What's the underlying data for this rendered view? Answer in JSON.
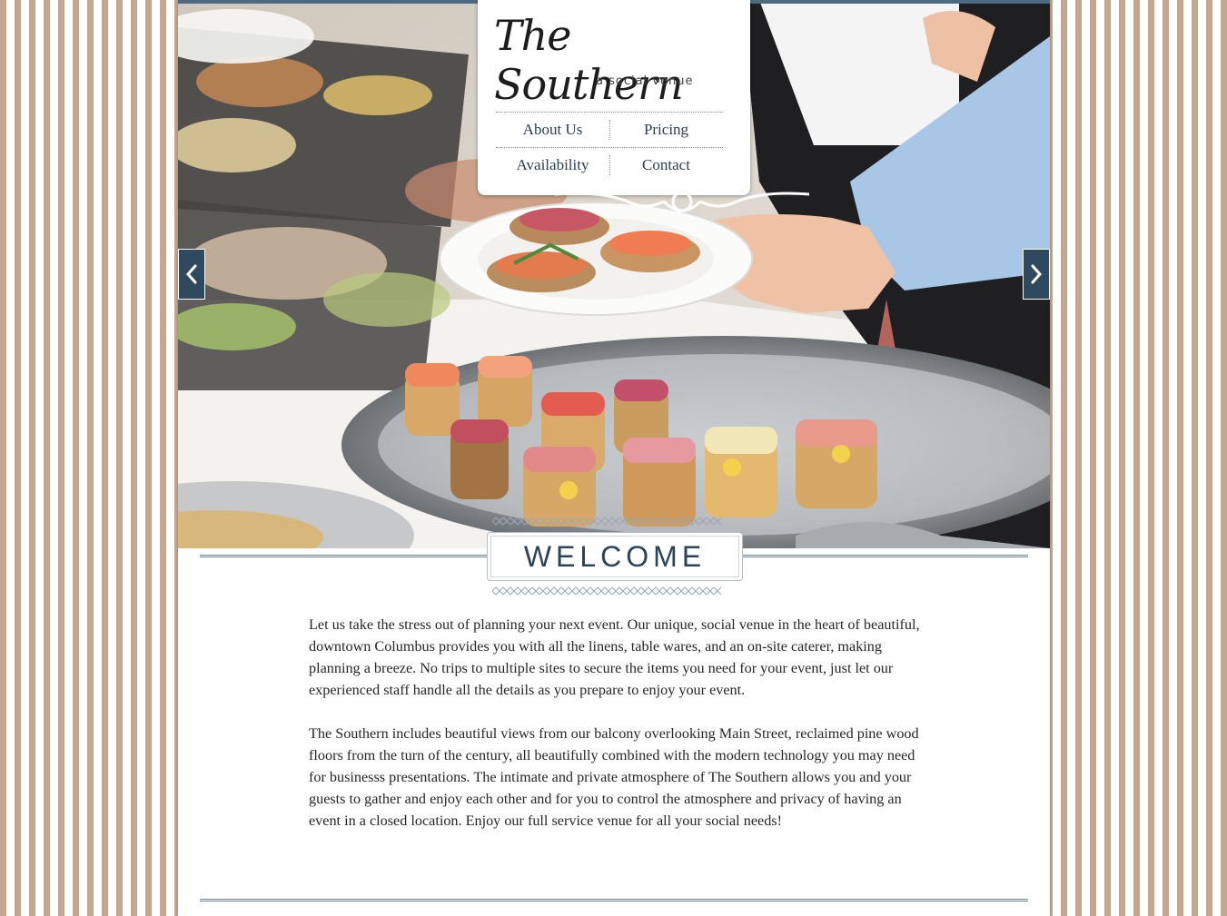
{
  "brand": {
    "logo_script": "The Southern",
    "tagline": "a social venue"
  },
  "nav": {
    "items": [
      {
        "label": "About Us"
      },
      {
        "label": "Pricing"
      },
      {
        "label": "Availability"
      },
      {
        "label": "Contact"
      }
    ]
  },
  "slider": {
    "prev_icon": "chevron-left-icon",
    "next_icon": "chevron-right-icon"
  },
  "welcome": {
    "heading": "WELCOME",
    "paragraphs": [
      "Let us take the stress out of planning your next event. Our unique, social venue in the heart of beautiful, downtown Columbus provides you with all the linens, table wares, and an on-site caterer, making planning a breeze. No trips to multiple sites to secure the items you need for your event, just let our experienced staff handle all the details as you prepare to enjoy your event.",
      "The Southern includes beautiful views from our balcony overlooking Main Street, reclaimed pine wood floors from the turn of the century, all beautifully combined with the modern technology you may need for businesss presentations. The intimate and private atmosphere of The Southern allows you and your guests to gather and enjoy each other and for you to control the atmosphere and privacy of having an event in a closed location. Enjoy our full service venue for all your social needs!"
    ]
  },
  "colors": {
    "stripe": "#c2a792",
    "accent": "#2f4a5e",
    "nav_text": "#2d3e4f",
    "heading": "#2b4457"
  }
}
